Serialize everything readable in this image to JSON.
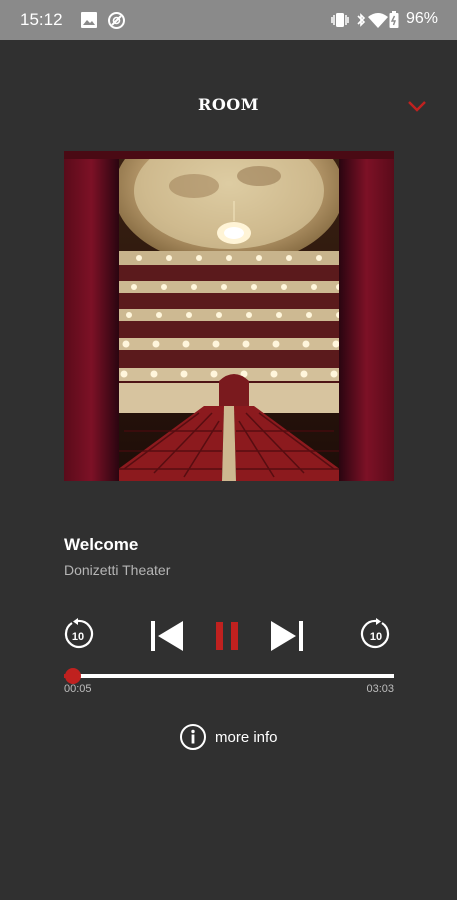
{
  "status_bar": {
    "time": "15:12",
    "battery_percent": "96%",
    "icons": [
      "gallery-icon",
      "do-not-disturb-icon",
      "vibrate-icon",
      "bluetooth-icon",
      "wifi-icon",
      "battery-icon"
    ]
  },
  "header": {
    "title": "ROOM",
    "collapse_icon": "chevron-down-icon"
  },
  "track": {
    "title": "Welcome",
    "subtitle": "Donizetti Theater"
  },
  "controls": {
    "rewind_seconds": "10",
    "forward_seconds": "10",
    "state": "playing",
    "icons": [
      "rewind-10-icon",
      "skip-previous-icon",
      "pause-icon",
      "skip-next-icon",
      "forward-10-icon"
    ]
  },
  "progress": {
    "elapsed": "00:05",
    "total": "03:03",
    "fraction": 0.027
  },
  "more_info": {
    "label": "more info",
    "icon": "info-circle-icon"
  },
  "colors": {
    "background": "#303030",
    "status_bar": "#8a8a8a",
    "accent": "#c0211f",
    "text": "#ffffff",
    "subtext": "#b5b5b5"
  }
}
